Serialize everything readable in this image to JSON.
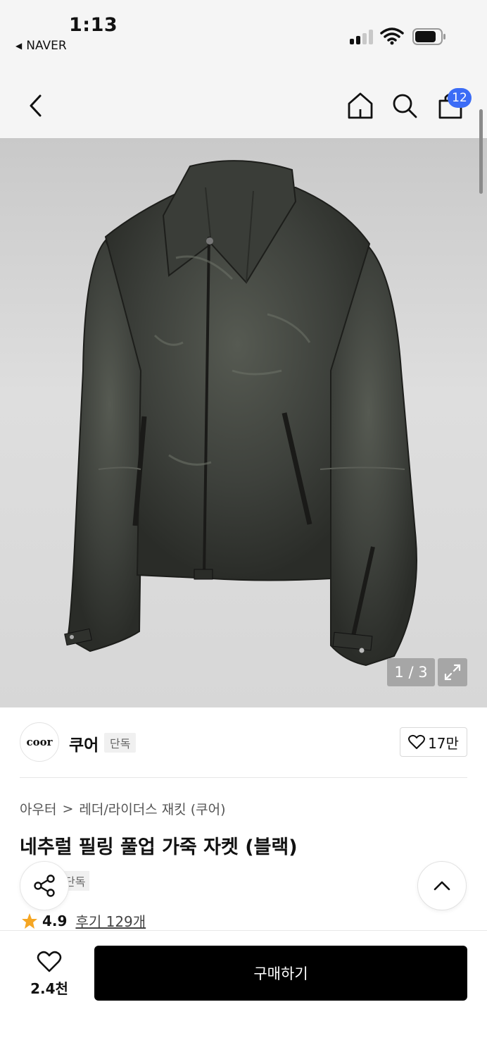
{
  "status_bar": {
    "time": "1:13",
    "back_app": "NAVER",
    "back_arrow": "◀"
  },
  "nav": {
    "cart_count": "12",
    "icons": [
      "back-chevron-icon",
      "home-icon",
      "search-icon",
      "shopping-bag-icon"
    ]
  },
  "gallery": {
    "counter": "1 / 3",
    "image_subject": "black distressed leather zip-up jacket"
  },
  "brand": {
    "logo_text": "coor",
    "name": "쿠어",
    "tag": "단독",
    "like_count": "17만"
  },
  "breadcrumb": {
    "category": "아우터",
    "separator": ">",
    "subcategory": "레더/라이더스 재킷 (쿠어)"
  },
  "product": {
    "title": "네추럴 필링 풀업 가죽 자켓 (블랙)",
    "tag": "단독",
    "rating": "4.9",
    "reviews": "후기 129개"
  },
  "bottom_bar": {
    "wish_count": "2.4천",
    "buy_label": "구매하기"
  },
  "colors": {
    "badge": "#3b6cf6",
    "star": "#f5a623",
    "buy_button": "#000000"
  }
}
